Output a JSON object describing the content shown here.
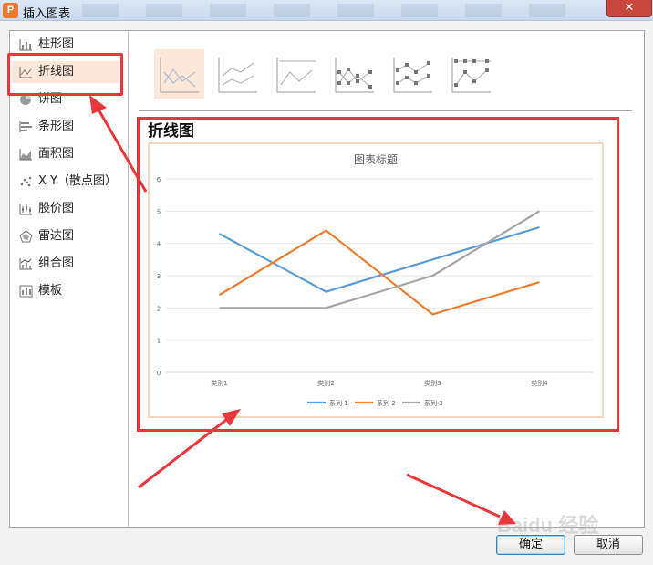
{
  "window": {
    "title": "插入图表",
    "app_icon": "wps-presentation-icon",
    "close_label": "✕"
  },
  "sidebar": {
    "items": [
      {
        "label": "柱形图",
        "icon": "column-chart-icon"
      },
      {
        "label": "折线图",
        "icon": "line-chart-icon",
        "selected": true
      },
      {
        "label": "饼图",
        "icon": "pie-chart-icon"
      },
      {
        "label": "条形图",
        "icon": "bar-chart-icon"
      },
      {
        "label": "面积图",
        "icon": "area-chart-icon"
      },
      {
        "label": "X Y（散点图）",
        "icon": "scatter-chart-icon"
      },
      {
        "label": "股价图",
        "icon": "stock-chart-icon"
      },
      {
        "label": "雷达图",
        "icon": "radar-chart-icon"
      },
      {
        "label": "组合图",
        "icon": "combo-chart-icon"
      },
      {
        "label": "模板",
        "icon": "template-icon"
      }
    ]
  },
  "subtypes": [
    {
      "icon": "line-icon",
      "markers": false,
      "stacked": false,
      "selected": true
    },
    {
      "icon": "stacked-line-icon",
      "markers": false,
      "stacked": true
    },
    {
      "icon": "percent-stacked-line-icon",
      "markers": false,
      "stacked": true
    },
    {
      "icon": "line-with-markers-icon",
      "markers": true,
      "stacked": false
    },
    {
      "icon": "stacked-line-with-markers-icon",
      "markers": true,
      "stacked": true
    },
    {
      "icon": "percent-stacked-line-with-markers-icon",
      "markers": true,
      "stacked": true
    }
  ],
  "preview": {
    "heading": "折线图"
  },
  "chart_data": {
    "type": "line",
    "title": "图表标题",
    "categories": [
      "类别1",
      "类别2",
      "类别3",
      "类别4"
    ],
    "series": [
      {
        "name": "系列 1",
        "values": [
          4.3,
          2.5,
          3.5,
          4.5
        ],
        "color": "#5b9bd5"
      },
      {
        "name": "系列 2",
        "values": [
          2.4,
          4.4,
          1.8,
          2.8
        ],
        "color": "#ed7d31"
      },
      {
        "name": "系列 3",
        "values": [
          2,
          2,
          3,
          5
        ],
        "color": "#a5a5a5"
      }
    ],
    "ylim": [
      0,
      6
    ],
    "yticks": [
      "0",
      "1",
      "2",
      "3",
      "4",
      "5",
      "6"
    ],
    "grid": true,
    "legend": "bottom"
  },
  "buttons": {
    "ok": "确定",
    "cancel": "取消"
  },
  "annotations": {
    "highlight_color": "#e8383d"
  },
  "watermark": "Baidu 经验"
}
